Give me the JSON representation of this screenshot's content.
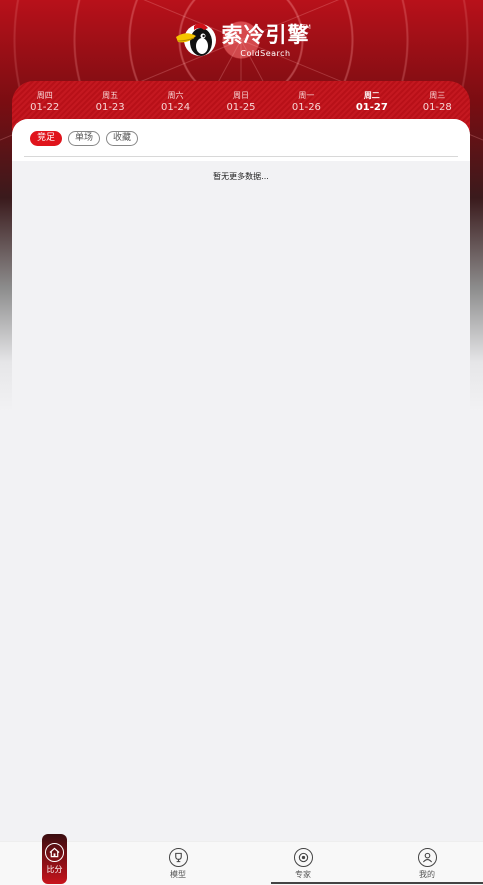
{
  "brand": {
    "name_cn": "索冷引擎",
    "name_en": "ColdSearch",
    "tm": "TM"
  },
  "dates": [
    {
      "weekday": "周四",
      "date": "01-22",
      "active": false
    },
    {
      "weekday": "周五",
      "date": "01-23",
      "active": false
    },
    {
      "weekday": "周六",
      "date": "01-24",
      "active": false
    },
    {
      "weekday": "周日",
      "date": "01-25",
      "active": false
    },
    {
      "weekday": "周一",
      "date": "01-26",
      "active": false
    },
    {
      "weekday": "周二",
      "date": "01-27",
      "active": true
    },
    {
      "weekday": "周三",
      "date": "01-28",
      "active": false
    }
  ],
  "filters": [
    {
      "label": "竞足",
      "active": true
    },
    {
      "label": "单场",
      "active": false
    },
    {
      "label": "收藏",
      "active": false
    }
  ],
  "empty_text": "暂无更多数据...",
  "tabs": [
    {
      "label": "比分",
      "icon": "home-icon",
      "active": true
    },
    {
      "label": "模型",
      "icon": "trophy-icon",
      "active": false
    },
    {
      "label": "专家",
      "icon": "expert-icon",
      "active": false
    },
    {
      "label": "我的",
      "icon": "user-icon",
      "active": false
    }
  ],
  "colors": {
    "primary": "#e0141c",
    "header_dark": "#7a0d12"
  }
}
